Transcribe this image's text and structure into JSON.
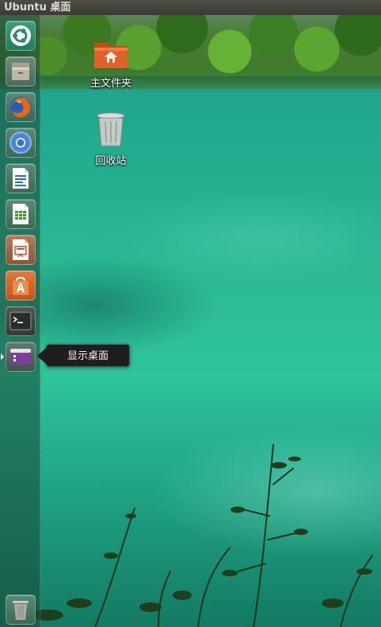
{
  "top_panel": {
    "title": "Ubuntu 桌面"
  },
  "launcher": {
    "items": [
      {
        "name": "dash-home",
        "icon": "ubuntu-logo-icon"
      },
      {
        "name": "files",
        "icon": "file-manager-icon"
      },
      {
        "name": "firefox",
        "icon": "firefox-icon"
      },
      {
        "name": "chromium",
        "icon": "chromium-icon"
      },
      {
        "name": "libreoffice-writer",
        "icon": "writer-icon"
      },
      {
        "name": "libreoffice-calc",
        "icon": "calc-icon"
      },
      {
        "name": "libreoffice-impress",
        "icon": "impress-icon"
      },
      {
        "name": "software-center",
        "icon": "software-center-icon"
      },
      {
        "name": "terminal",
        "icon": "terminal-icon"
      },
      {
        "name": "show-desktop",
        "icon": "show-desktop-icon"
      },
      {
        "name": "trash",
        "icon": "trash-icon"
      }
    ],
    "tooltip": "显示桌面"
  },
  "desktop": {
    "icons": [
      {
        "label": "主文件夹",
        "icon": "home-folder-icon"
      },
      {
        "label": "回收站",
        "icon": "trash-icon"
      }
    ]
  },
  "colors": {
    "panel": "#3c3b37",
    "accent_orange": "#e0622a",
    "water": "#2cbb93"
  }
}
